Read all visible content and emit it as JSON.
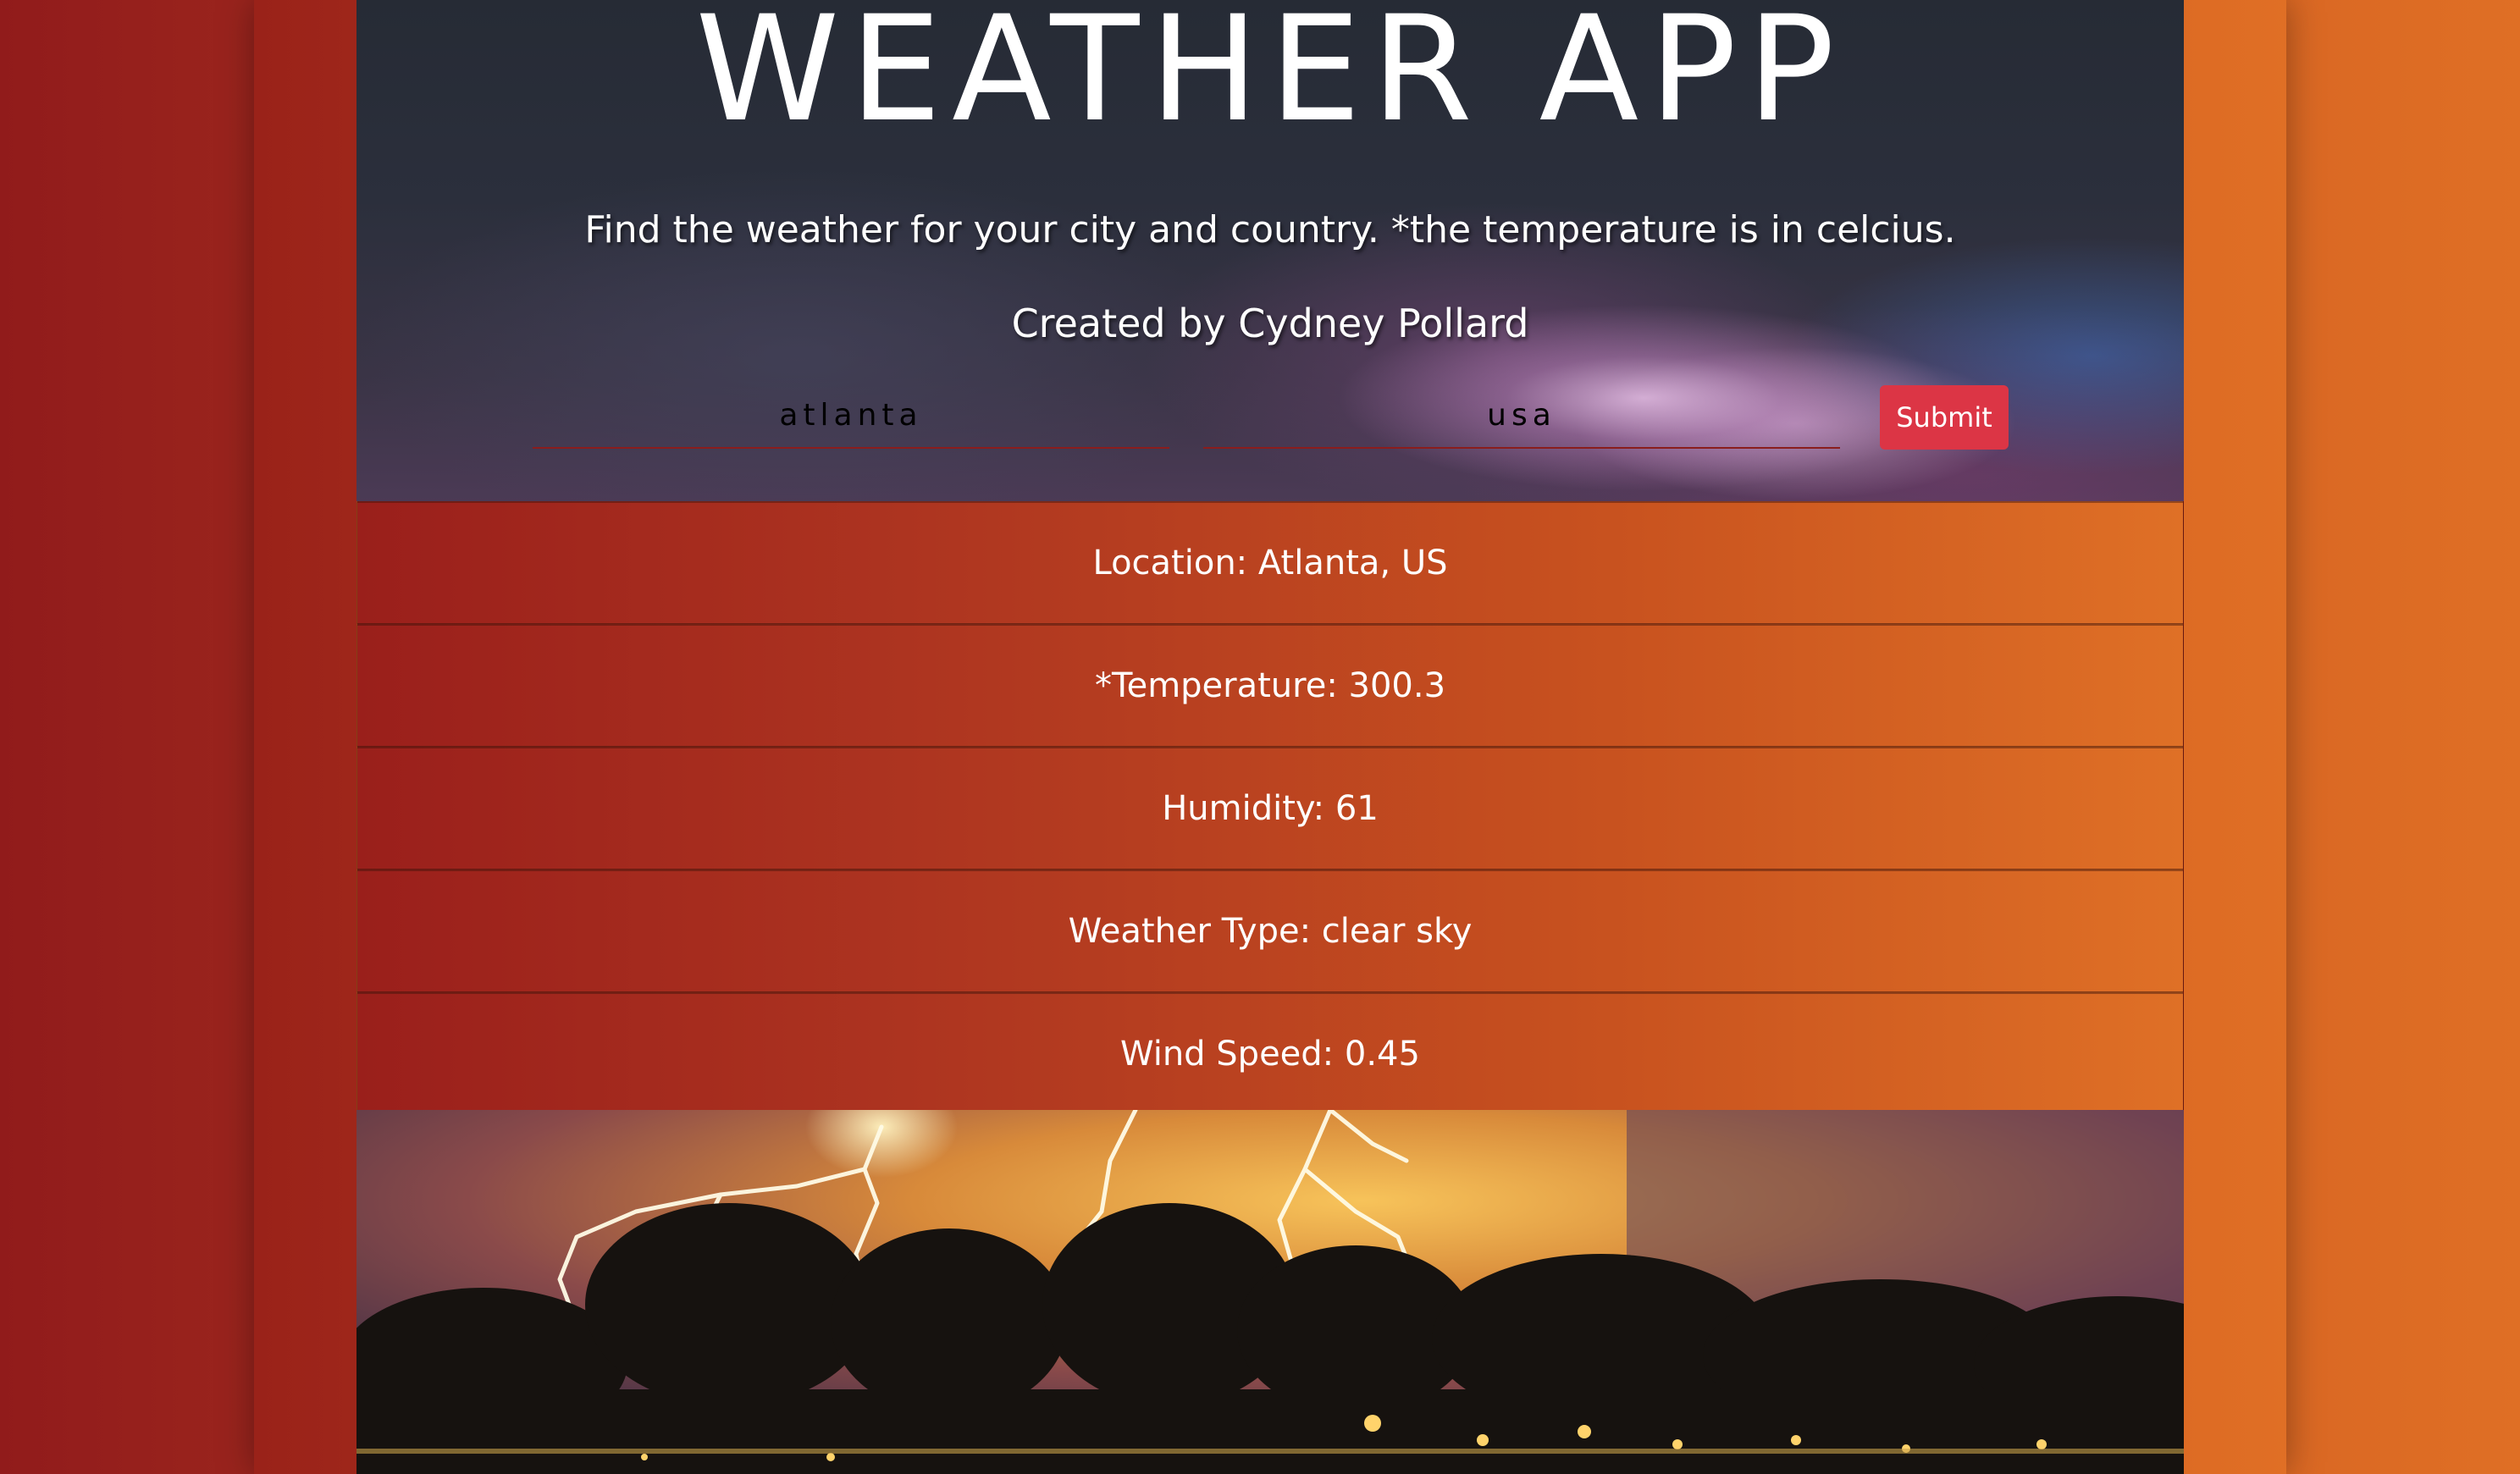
{
  "header": {
    "title": "WEATHER APP",
    "subtitle": "Find the weather for your city and country. *the temperature is in celcius.",
    "credit": "Created by Cydney Pollard"
  },
  "form": {
    "city_value": "atlanta",
    "country_value": "usa",
    "submit_label": "Submit"
  },
  "results": {
    "location": "Location: Atlanta, US",
    "temperature": "*Temperature: 300.3",
    "humidity": "Humidity: 61",
    "weather_type": "Weather Type: clear sky",
    "wind_speed": "Wind Speed: 0.45"
  },
  "colors": {
    "submit_button": "#dc3545",
    "gradient_start": "#911b1b",
    "gradient_end": "#df6f25"
  },
  "images": {
    "header_background": "stormy-sky-image",
    "footer_image": "lightning-storm-image"
  }
}
